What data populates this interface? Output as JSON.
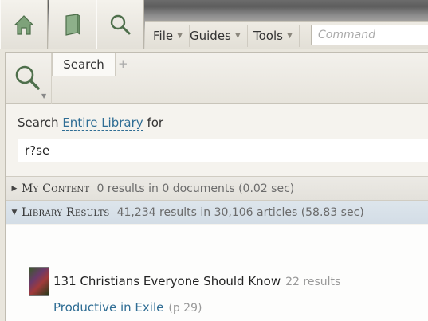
{
  "toolbar": {
    "tabs": [
      {
        "icon": "home-icon"
      },
      {
        "icon": "book-icon"
      },
      {
        "icon": "search-icon"
      }
    ],
    "menus": [
      {
        "label": "File"
      },
      {
        "label": "Guides"
      },
      {
        "label": "Tools"
      }
    ],
    "command_placeholder": "Command"
  },
  "panel": {
    "tab_label": "Search",
    "add_tab": "+",
    "search_prefix": "Search",
    "scope": "Entire Library",
    "search_suffix": "for",
    "query": "r?se"
  },
  "sections": [
    {
      "name": "My Content",
      "meta": "0 results in 0 documents (0.02 sec)",
      "expanded": false
    },
    {
      "name": "Library Results",
      "meta": "41,234 results in 30,106 articles (58.83 sec)",
      "expanded": true
    }
  ],
  "results": {
    "book_title": "131 Christians Everyone Should Know",
    "book_count": "22 results",
    "article_title": "Productive in Exile",
    "article_page": "(p 29)"
  },
  "colors": {
    "link": "#2f6d94",
    "library_row": "#d8e1e9"
  }
}
